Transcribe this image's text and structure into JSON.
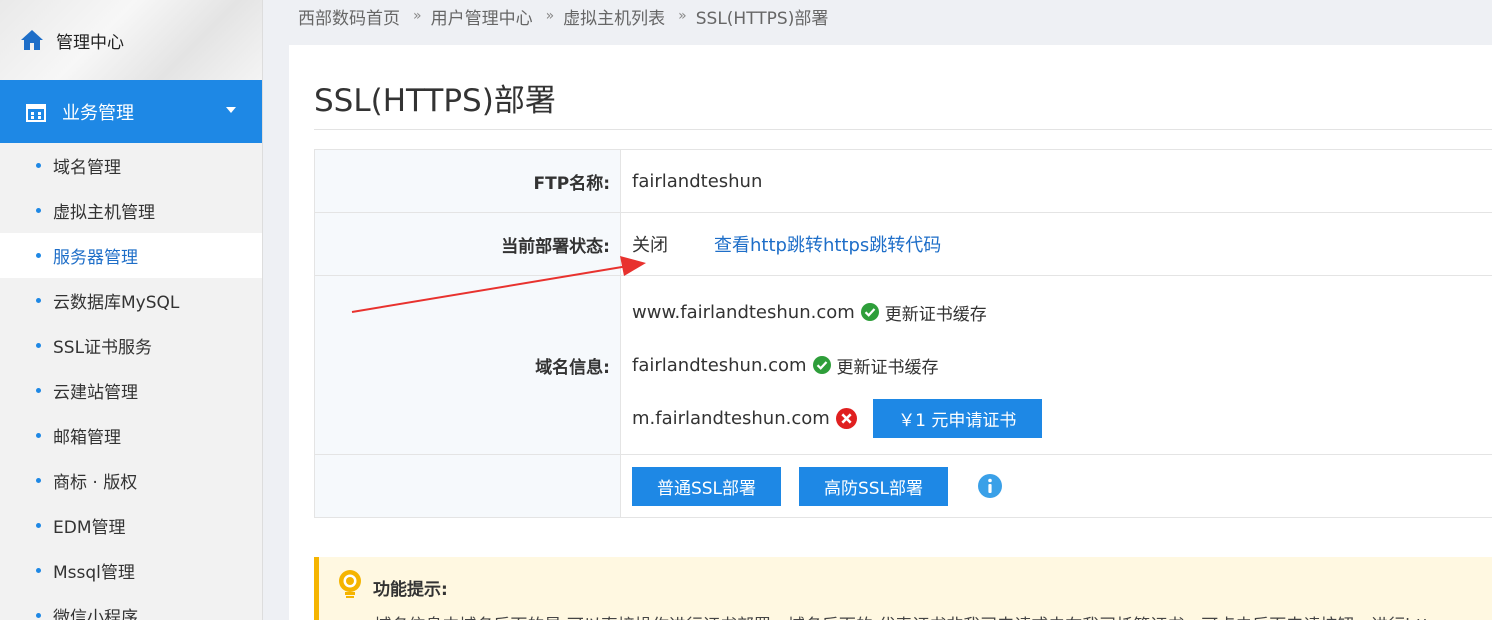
{
  "sidebar": {
    "home_label": "管理中心",
    "biz_label": "业务管理",
    "items": [
      {
        "label": "域名管理",
        "active": false
      },
      {
        "label": "虚拟主机管理",
        "active": false
      },
      {
        "label": "服务器管理",
        "active": true
      },
      {
        "label": "云数据库MySQL",
        "active": false
      },
      {
        "label": "SSL证书服务",
        "active": false
      },
      {
        "label": "云建站管理",
        "active": false
      },
      {
        "label": "邮箱管理",
        "active": false
      },
      {
        "label": "商标 · 版权",
        "active": false
      },
      {
        "label": "EDM管理",
        "active": false
      },
      {
        "label": "Mssql管理",
        "active": false
      },
      {
        "label": "微信小程序",
        "active": false
      }
    ]
  },
  "breadcrumb": [
    "西部数码首页",
    "用户管理中心",
    "虚拟主机列表",
    "SSL(HTTPS)部署"
  ],
  "page": {
    "title": "SSL(HTTPS)部署",
    "ftp_label": "FTP名称:",
    "ftp_value": "fairlandteshun",
    "status_label": "当前部署状态:",
    "status_value": "关闭",
    "redirect_link": "查看http跳转https跳转代码",
    "domain_label": "域名信息:",
    "domains": [
      {
        "name": "www.fairlandteshun.com",
        "ok": true,
        "action": "更新证书缓存"
      },
      {
        "name": "fairlandteshun.com",
        "ok": true,
        "action": "更新证书缓存"
      },
      {
        "name": "m.fairlandteshun.com",
        "ok": false,
        "action": "￥1 元申请证书"
      }
    ],
    "btn_normal": "普通SSL部署",
    "btn_ddos": "高防SSL部署"
  },
  "tip": {
    "title": "功能提示:",
    "text": "• 域名信息中域名后面的是 可以直接操作进行证书部署；域名后面的 代表证书非我司申请或未在我司托管证书，可点击后面申请按钮，进行https"
  },
  "colors": {
    "accent": "#1e88e5",
    "ok": "#2e9e3a",
    "error": "#e02020",
    "warn": "#f5b400"
  }
}
